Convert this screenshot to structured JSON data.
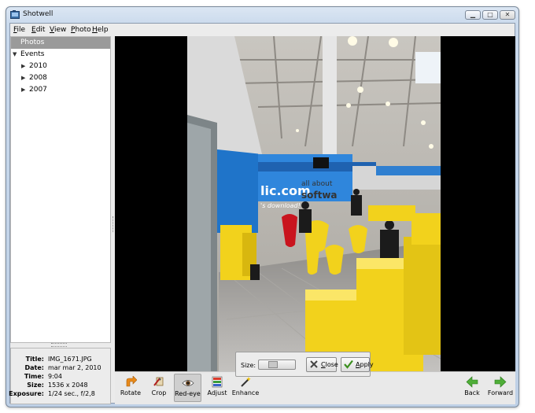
{
  "window": {
    "title": "Shotwell",
    "minimize_symbol": "▁",
    "maximize_symbol": "□",
    "close_symbol": "✕"
  },
  "menu": [
    {
      "label": "File",
      "mnemonic": "F",
      "rest": "ile"
    },
    {
      "label": "Edit",
      "mnemonic": "E",
      "rest": "dit"
    },
    {
      "label": "View",
      "mnemonic": "V",
      "rest": "iew"
    },
    {
      "label": "Photo",
      "mnemonic": "P",
      "rest": "hoto"
    },
    {
      "label": "Help",
      "mnemonic": "H",
      "rest": "elp"
    }
  ],
  "sidebar": {
    "items": [
      {
        "label": "Photos",
        "selected": true
      },
      {
        "label": "Events",
        "expanded": true
      },
      {
        "label": "2010",
        "expanded": false
      },
      {
        "label": "2008",
        "expanded": false
      },
      {
        "label": "2007",
        "expanded": false
      }
    ]
  },
  "info": {
    "rows": [
      {
        "key": "Title:",
        "value": "IMG_1671.JPG"
      },
      {
        "key": "Date:",
        "value": "mar mar 2, 2010"
      },
      {
        "key": "Time:",
        "value": "9:04"
      },
      {
        "key": "Size:",
        "value": "1536 x 2048"
      },
      {
        "key": "Exposure:",
        "value": "1/24 sec., f/2,8"
      }
    ]
  },
  "photo": {
    "booth_text_1": "lic.com",
    "booth_text_2": "'s download!",
    "booth_text_3": "all about",
    "booth_text_4": "softwa"
  },
  "toolbar": {
    "rotate": "Rotate",
    "crop": "Crop",
    "redeye": "Red-eye",
    "adjust": "Adjust",
    "enhance": "Enhance",
    "back": "Back",
    "forward": "Forward"
  },
  "redeye_popup": {
    "size_label": "Size:",
    "size_value": 0.35,
    "close_label": "Close",
    "close_mnemonic": "C",
    "close_rest": "lose",
    "apply_label": "Apply",
    "apply_mnemonic": "A",
    "apply_rest": "pply"
  },
  "colors": {
    "selection": "#9a9a9a",
    "booth_blue": "#1f74c9",
    "booth_yellow": "#f2d21c"
  }
}
